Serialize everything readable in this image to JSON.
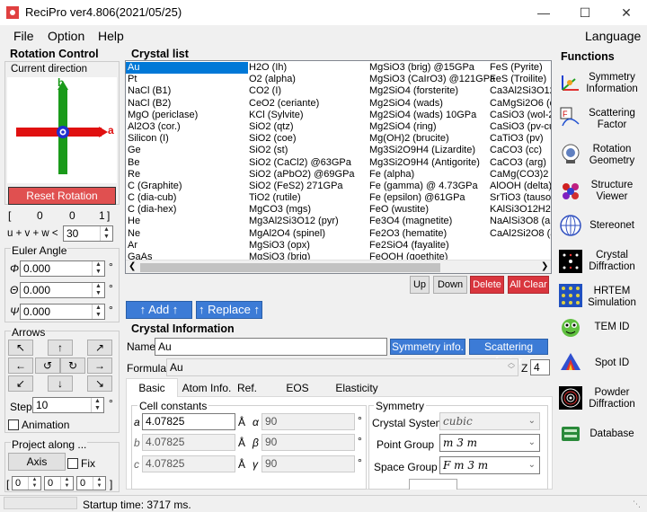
{
  "window": {
    "title": "ReciPro  ver4.806(2021/05/25)"
  },
  "menu": {
    "file": "File",
    "option": "Option",
    "help": "Help",
    "language": "Language"
  },
  "rotation": {
    "title": "Rotation Control",
    "current_direction": "Current direction",
    "axis_b": "b",
    "axis_a": "a",
    "reset_label": "Reset Rotation",
    "index_open": "[",
    "index_u": "0",
    "index_v": "0",
    "index_w": "1",
    "index_close": "]",
    "uvw_label": "u + v + w <",
    "uvw_value": "30",
    "euler_title": "Euler Angle",
    "phi_symbol": "Φ",
    "phi": "0.000",
    "theta_symbol": "Θ",
    "theta": "0.000",
    "psi_symbol": "Ψ",
    "psi": "0.000",
    "degree": "°",
    "arrows_title": "Arrows",
    "arrows": [
      "↖",
      "↑",
      "↗",
      "←",
      "↺",
      "↻",
      "→",
      "↙",
      "↓",
      "↘"
    ],
    "step_label": "Step",
    "step_value": "10",
    "animation_label": "Animation",
    "project_title": "Project along ...",
    "axis_button": "Axis",
    "fix_label": "Fix",
    "proj_open": "[",
    "proj_u": "0",
    "proj_v": "0",
    "proj_w": "0",
    "proj_close": "]"
  },
  "crystal_list": {
    "title": "Crystal list",
    "columns": [
      [
        "Au",
        "Pt",
        "NaCl (B1)",
        "NaCl (B2)",
        "MgO (periclase)",
        "Al2O3 (cor.)",
        "Silicon (I)",
        "Ge",
        "Be",
        "Re",
        "C (Graphite)",
        "C (dia-cub)",
        "C (dia-hex)",
        "He",
        "Ne",
        "Ar",
        "GaAs"
      ],
      [
        "H2O (Ih)",
        "O2 (alpha)",
        "CO2 (I)",
        "CeO2 (ceriante)",
        "KCl (Sylvite)",
        "SiO2 (qtz)",
        "SiO2 (coe)",
        "SiO2 (st)",
        "SiO2 (CaCl2) @63GPa",
        "SiO2 (aPbO2) @69GPa",
        "SiO2 (FeS2) 271GPa",
        "TiO2 (rutile)",
        "MgCO3 (mgs)",
        "Mg3Al2Si3O12 (pyr)",
        "MgAl2O4 (spinel)",
        "MgSiO3 (opx)",
        "MgSiO3 (brig)"
      ],
      [
        "MgSiO3 (brig) @15GPa",
        "MgSiO3 (CaIrO3) @121GPa",
        "Mg2SiO4 (forsterite)",
        "Mg2SiO4 (wads)",
        "Mg2SiO4 (wads) 10GPa",
        "Mg2SiO4 (ring)",
        "Mg(OH)2 (brucite)",
        "Mg3Si2O9H4 (Lizardite)",
        "Mg3Si2O9H4 (Antigorite)",
        "Fe (alpha)",
        "Fe (gamma) @ 4.73GPa",
        "Fe (epsilon) @61GPa",
        "FeO (wustite)",
        "Fe3O4 (magnetite)",
        "Fe2O3 (hematite)",
        "Fe2SiO4 (fayalite)",
        "FeOOH (goethite)"
      ],
      [
        "FeS (Pyrite)",
        "FeS (Troilite)",
        "Ca3Al2Si3O12",
        "CaMgSi2O6 (d",
        "CaSiO3 (wol-2",
        "CaSiO3 (pv-cu",
        "CaTiO3 (pv)",
        "CaCO3 (cc)",
        "CaCO3 (arg)",
        "CaMg(CO3)2 (",
        "AlOOH (delta)",
        "SrTiO3 (tausor",
        "KAlSi3O12H2",
        "NaAlSi3O8 (all",
        "CaAl2Si2O8 (a",
        "",
        ""
      ]
    ],
    "up": "Up",
    "down": "Down",
    "delete": "Delete",
    "all_clear": "All Clear",
    "add": "↑ Add ↑",
    "replace": "↑ Replace ↑"
  },
  "crystal_info": {
    "title": "Crystal Information",
    "name_label": "Name",
    "name_value": "Au",
    "symmetry_info": "Symmetry info.",
    "scattering_factor": "Scattering factor",
    "formula_label": "Formula",
    "formula_value": "Au",
    "z_label": "Z",
    "z_value": "4",
    "tabs": [
      "Basic Info.",
      "Atom Info.",
      "Ref.",
      "EOS",
      "Elasticity"
    ],
    "cell_title": "Cell constants",
    "a_sym": "a",
    "a_val": "4.07825",
    "b_sym": "b",
    "b_val": "4.07825",
    "c_sym": "c",
    "c_val": "4.07825",
    "ang_unit": "Å",
    "alpha_sym": "α",
    "alpha_val": "90",
    "beta_sym": "β",
    "beta_val": "90",
    "gamma_sym": "γ",
    "gamma_val": "90",
    "deg": "°",
    "symmetry_title": "Symmetry",
    "crystal_system_label": "Crystal System",
    "crystal_system_value": "cubic",
    "point_group_label": "Point Group",
    "point_group_value": "m 3 m",
    "space_group_label": "Space Group",
    "space_group_value": "F m 3 m"
  },
  "functions": {
    "title": "Functions",
    "items": [
      {
        "label": "Symmetry Information",
        "icon": "symmetry-icon"
      },
      {
        "label": "Scattering Factor",
        "icon": "scattering-icon"
      },
      {
        "label": "Rotation Geometry",
        "icon": "rotation-icon"
      },
      {
        "label": "Structure Viewer",
        "icon": "structure-icon"
      },
      {
        "label": "Stereonet",
        "icon": "stereonet-icon"
      },
      {
        "label": "Crystal Diffraction",
        "icon": "diffraction-icon"
      },
      {
        "label": "HRTEM Simulation",
        "icon": "hrtem-icon"
      },
      {
        "label": "TEM ID",
        "icon": "temid-icon"
      },
      {
        "label": "Spot ID",
        "icon": "spotid-icon"
      },
      {
        "label": "Powder Diffraction",
        "icon": "powder-icon"
      },
      {
        "label": "Database",
        "icon": "database-icon"
      }
    ]
  },
  "status": {
    "text": "Startup time: 3717 ms."
  }
}
